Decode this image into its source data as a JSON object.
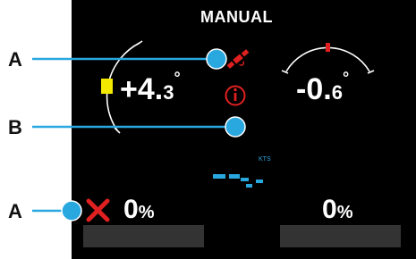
{
  "mode_title": "MANUAL",
  "callouts": {
    "a_top": "A",
    "b": "B",
    "a_bottom": "A"
  },
  "gauge_left": {
    "sign_value": "+4.",
    "decimal": "3",
    "unit": "°"
  },
  "gauge_right": {
    "sign_value": "-0.",
    "decimal": "6",
    "unit": "°"
  },
  "speed_unit": "KTS",
  "left_percent": {
    "value": "0",
    "unit": "%"
  },
  "right_percent": {
    "value": "0",
    "unit": "%"
  },
  "colors": {
    "accent": "#29a8e0",
    "alert": "#e02020",
    "yellow": "#f2e800",
    "panel": "#333333"
  },
  "icons": {
    "gps": "satellite-icon",
    "info": "info-circle-icon",
    "error": "x-cross-icon"
  }
}
